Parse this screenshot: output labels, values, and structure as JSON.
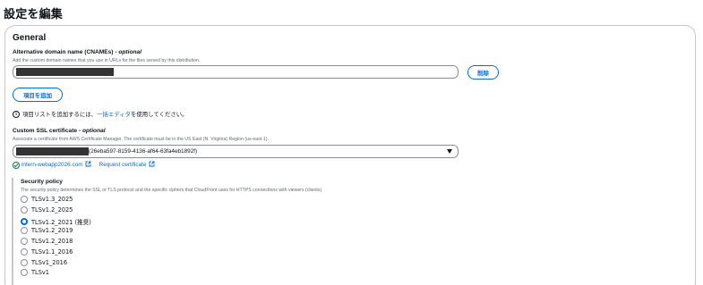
{
  "page": {
    "title": "設定を編集"
  },
  "general": {
    "heading": "General",
    "cname": {
      "label": "Alternative domain name (CNAMEs)",
      "optional": "optional",
      "description": "Add the custom domain names that you use in URLs for the files served by this distribution.",
      "remove_label": "削除",
      "add_label": "項目を追加"
    },
    "info": {
      "prefix": "項目リストを追加するには、",
      "link": "一括エディタ",
      "suffix": " を使用してください。"
    },
    "ssl": {
      "label": "Custom SSL certificate",
      "optional": "optional",
      "description": "Associate a certificate from AWS Certificate Manager. The certificate must be in the US East (N. Virginia) Region (us-east-1).",
      "selected_value": "(26eba597-8159-4136-af64-63fa4eb1892f)",
      "domain_link": "intern-webapp2026.com",
      "request_link": "Request certificate"
    },
    "security_policy": {
      "label": "Security policy",
      "description": "The security policy determines the SSL or TLS protocol and the specific ciphers that CloudFront uses for HTTPS connections with viewers (clients).",
      "options": [
        {
          "label": "TLSv1.3_2025",
          "selected": false
        },
        {
          "label": "TLSv1.2_2025",
          "selected": false
        },
        {
          "label": "TLSv1.2_2021 (推奨)",
          "selected": true
        },
        {
          "label": "TLSv1.2_2019",
          "selected": false
        },
        {
          "label": "TLSv1.2_2018",
          "selected": false
        },
        {
          "label": "TLSv1.1_2016",
          "selected": false
        },
        {
          "label": "TLSv1_2016",
          "selected": false
        },
        {
          "label": "TLSv1",
          "selected": false
        }
      ]
    }
  },
  "colors": {
    "accent": "#006ce0",
    "success": "#007a3d",
    "redaction": "#333333"
  }
}
